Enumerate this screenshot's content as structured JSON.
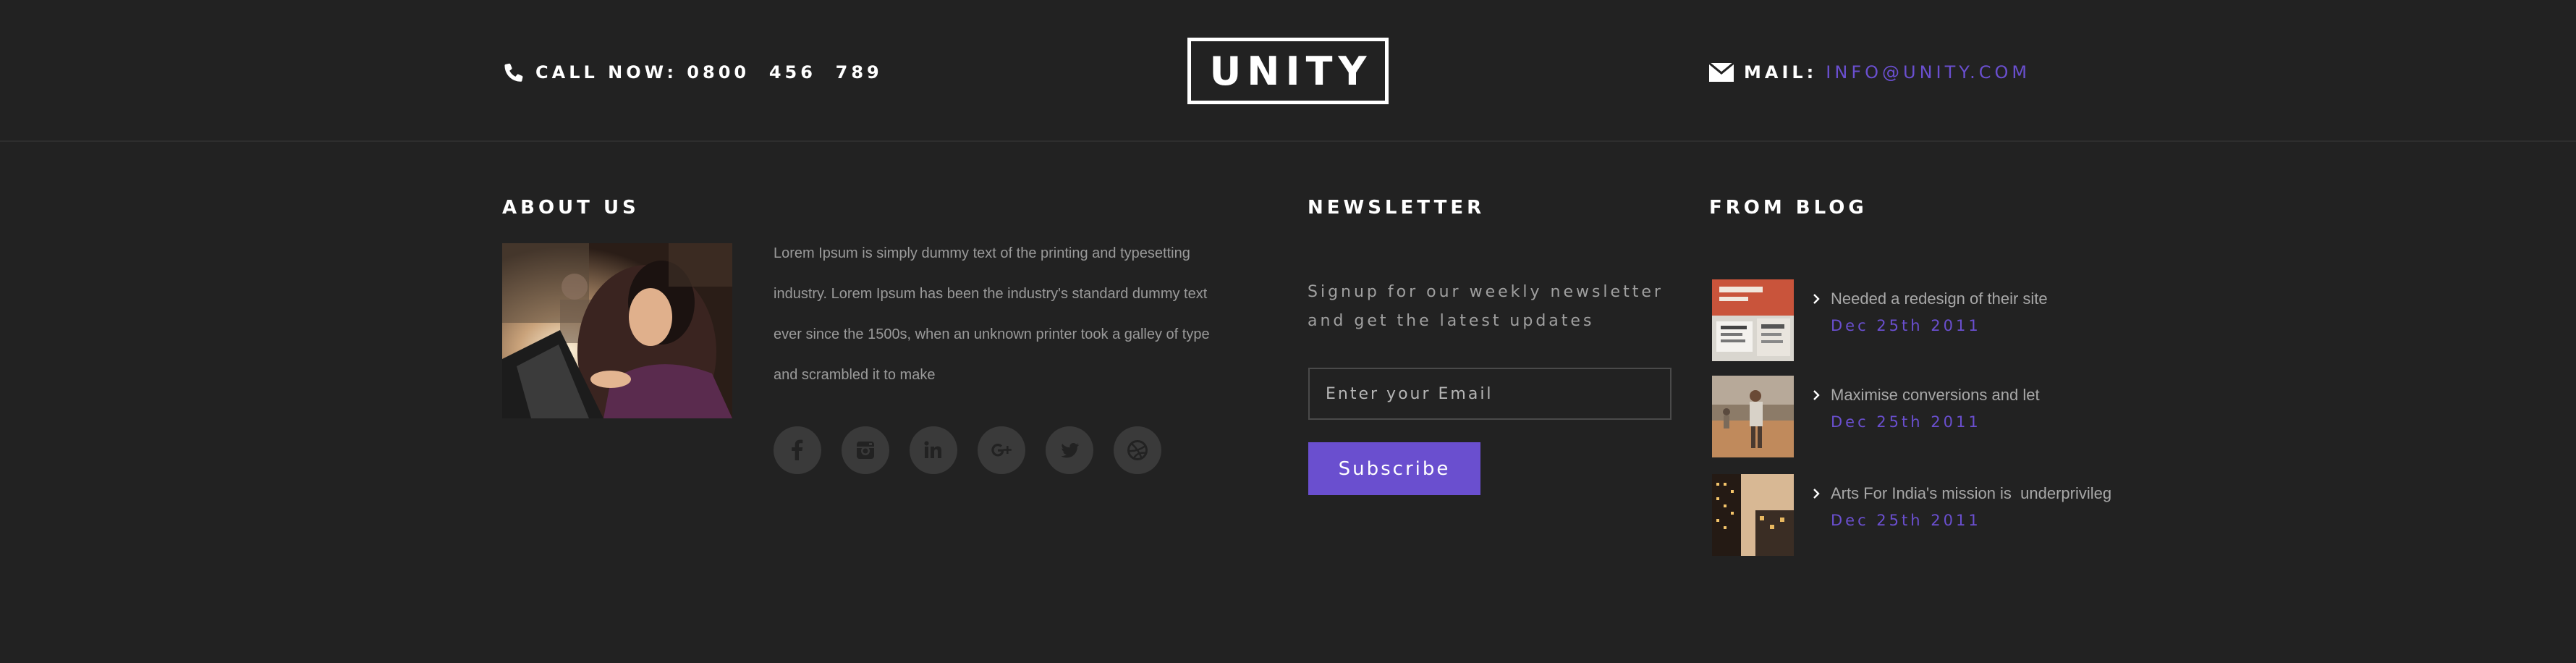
{
  "colors": {
    "accent": "#6a4fcf",
    "background": "#222222"
  },
  "header": {
    "call_label": "CALL NOW: 0800  456  789",
    "logo_text": "UNITY",
    "mail_label": "MAIL:",
    "mail_value": "INFO@UNITY.COM"
  },
  "about": {
    "heading": "ABOUT US",
    "text": "Lorem Ipsum is simply dummy text of the printing and typesetting industry. Lorem Ipsum has been the industry's standard dummy text ever since the 1500s, when an unknown printer took a galley of type and scrambled it to make",
    "socials": [
      "facebook-icon",
      "instagram-icon",
      "linkedin-icon",
      "google-plus-icon",
      "twitter-icon",
      "dribbble-icon"
    ]
  },
  "newsletter": {
    "heading": "NEWSLETTER",
    "text": "Signup for our weekly newsletter and get the latest updates",
    "email_placeholder": "Enter your Email",
    "subscribe_label": "Subscribe"
  },
  "blog": {
    "heading": "FROM BLOG",
    "posts": [
      {
        "title": "Needed a redesign of their site",
        "date": "Dec 25th 2011"
      },
      {
        "title": "Maximise conversions and let",
        "date": "Dec 25th 2011"
      },
      {
        "title": "Arts For India's mission is  underprivileg",
        "date": "Dec 25th 2011"
      }
    ]
  }
}
